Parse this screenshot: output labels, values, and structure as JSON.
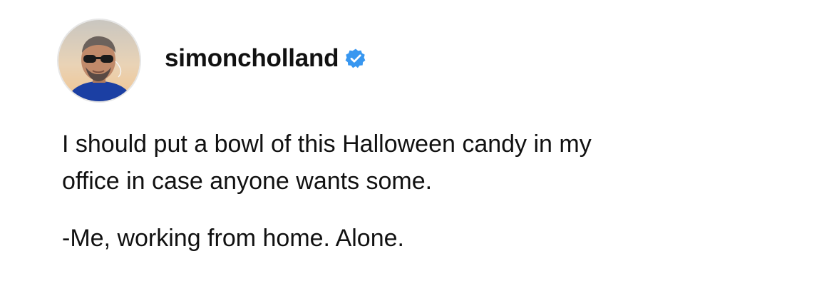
{
  "post": {
    "username": "simoncholland",
    "verified_icon": "verified-badge-icon",
    "accent_color": "#3897f0",
    "caption_line1": "I should put a bowl of this Halloween candy in my",
    "caption_line2": "office in case anyone wants some.",
    "caption_signature": "-Me, working from home. Alone."
  }
}
